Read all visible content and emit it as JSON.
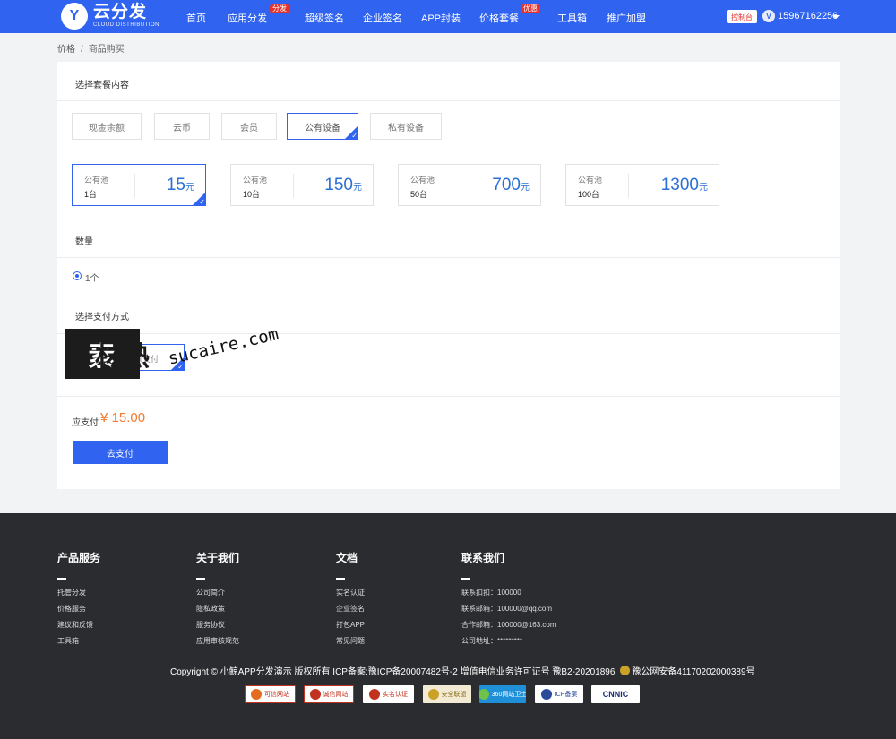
{
  "nav": {
    "logo_letter": "Y",
    "logo_title": "云分发",
    "logo_sub": "CLOUD DISTRIBUTION",
    "items": [
      {
        "label": "首页"
      },
      {
        "label": "应用分发",
        "badge": "分发"
      },
      {
        "label": "超级签名"
      },
      {
        "label": "企业签名"
      },
      {
        "label": "APP封装"
      },
      {
        "label": "价格套餐",
        "badge": "优惠"
      },
      {
        "label": "工具箱"
      },
      {
        "label": "推广加盟"
      }
    ],
    "console": "控制台",
    "avatar_letter": "V",
    "user": "15967162256"
  },
  "breadcrumb": {
    "root": "价格",
    "sep": "/",
    "current": "商品购买"
  },
  "section_package": "选择套餐内容",
  "categories": [
    "现金余额",
    "云币",
    "会员",
    "公有设备",
    "私有设备"
  ],
  "selected_category": "公有设备",
  "packages": [
    {
      "name": "公有池",
      "qty": "1台",
      "price": "15",
      "unit": "元"
    },
    {
      "name": "公有池",
      "qty": "10台",
      "price": "150",
      "unit": "元"
    },
    {
      "name": "公有池",
      "qty": "50台",
      "price": "700",
      "unit": "元"
    },
    {
      "name": "公有池",
      "qty": "100台",
      "price": "1300",
      "unit": "元"
    }
  ],
  "section_quantity": "数量",
  "quantity_option": "1个",
  "section_payment": "选择支付方式",
  "payment_option": "余额支付",
  "due": {
    "label": "应支付",
    "amount": "¥ 15.00"
  },
  "pay_button": "去支付",
  "watermark": {
    "box": "素",
    "rest": "材熱",
    "url": "sucaire.com"
  },
  "footer": {
    "columns": [
      {
        "title": "产品服务",
        "items": [
          "托管分发",
          "价格服务",
          "建议和反馈",
          "工具箱"
        ]
      },
      {
        "title": "关于我们",
        "items": [
          "公司简介",
          "隐私政策",
          "服务协议",
          "应用审核规范"
        ]
      },
      {
        "title": "文档",
        "items": [
          "实名认证",
          "企业签名",
          "打包APP",
          "常见问题"
        ]
      },
      {
        "title": "联系我们",
        "items": [
          "联系扣扣：100000",
          "联系邮箱：100000@qq.com",
          "合作邮箱：100000@163.com",
          "公司地址：*********"
        ]
      }
    ],
    "copyright": "Copyright © 小鲸APP分发演示 版权所有 ICP备案:豫ICP备20007482号-2 增值电信业务许可证号 豫B2-20201896",
    "police": "豫公网安备41170202000389号",
    "badges": [
      "可信网站",
      "诚信网站",
      "实名认证",
      "安全联盟",
      "360网站卫士",
      "ICP备案",
      "CNNIC"
    ]
  },
  "colors": {
    "primary": "#2f63f0",
    "price": "#2a6fd6",
    "due": "#f07a2e",
    "footer_bg": "#2b2c2f",
    "badge_red": "#e5322d"
  }
}
